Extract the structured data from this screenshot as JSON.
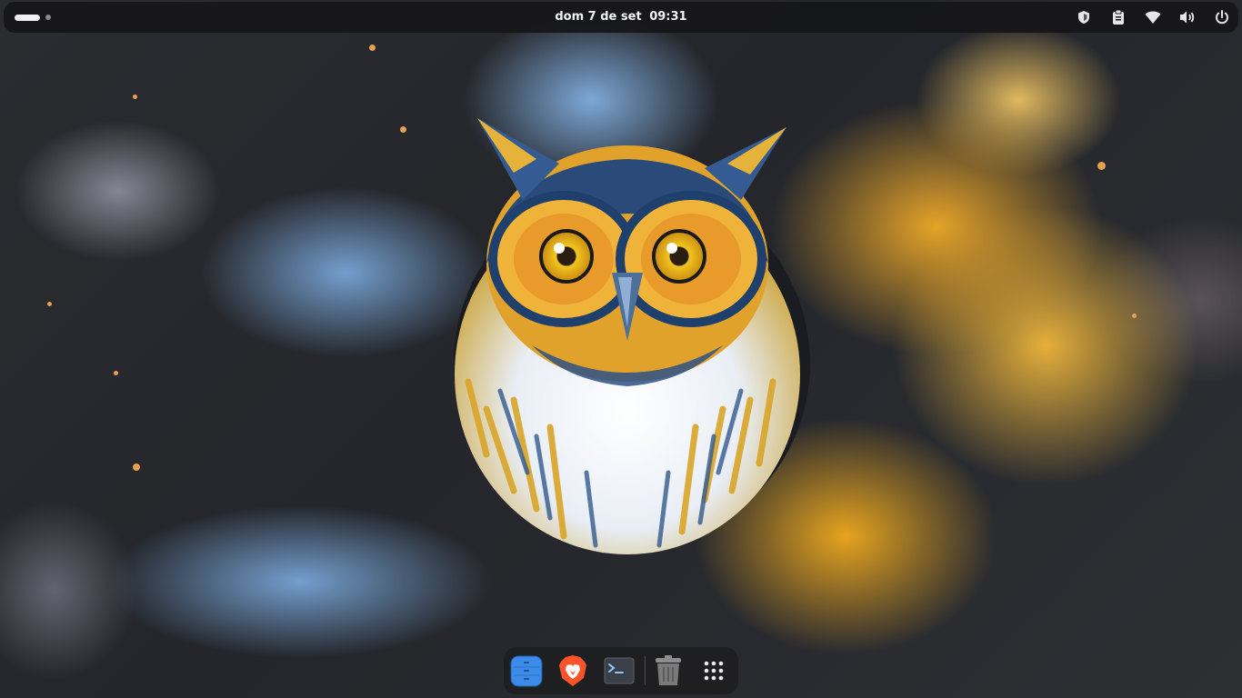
{
  "topbar": {
    "date": "dom 7 de set",
    "time": "09:31",
    "workspaces": {
      "count": 2,
      "active": 1
    },
    "tray_icons": [
      "shield-icon",
      "clipboard-icon",
      "wifi-icon",
      "volume-icon",
      "power-icon"
    ]
  },
  "dock": {
    "items": [
      {
        "name": "files-app",
        "icon": "files-icon"
      },
      {
        "name": "brave-browser",
        "icon": "brave-lion-icon"
      },
      {
        "name": "terminal",
        "icon": "terminal-icon"
      },
      {
        "name": "trash",
        "icon": "trash-icon"
      },
      {
        "name": "show-apps",
        "icon": "app-grid-icon"
      }
    ]
  },
  "colors": {
    "bar_bg": "#161618",
    "accent_blue": "#3d8be8",
    "brave_orange": "#fb542b",
    "wallpaper_yellow": "#f0aa28",
    "wallpaper_blue": "#78a5d7"
  }
}
